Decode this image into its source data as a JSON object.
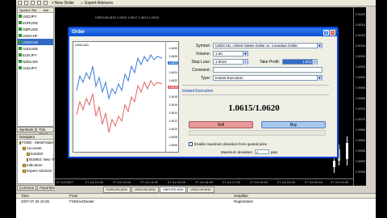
{
  "toolbar": {
    "new_order": "New Order",
    "expert_advisors": "Expert Advisors"
  },
  "market_watch": {
    "columns": [
      "Symbol",
      "Bid",
      "Ask"
    ],
    "symbols": [
      "USDJPY",
      "EURUSD",
      "GBPUSD",
      "USDCHF",
      "USDCAD",
      "AUDUSD",
      "EURJPY",
      "NZDUSD",
      "AUDJPY"
    ],
    "selected": "USDCAD",
    "tabs": [
      "Symbols",
      "Tick Chart"
    ]
  },
  "navigator": {
    "title": "Navigator",
    "items": [
      "FXDD - MetaTrader",
      "Accounts",
      "843300:",
      "915953: New Trader",
      "Indicators",
      "Expert Advisors"
    ],
    "tabs": [
      "Common",
      "Favorites"
    ]
  },
  "chart": {
    "title": "USDCAD,M15 1.0615 1.0617 1.0613 1.0615",
    "price_ticks": [
      "2.0020",
      "2.0015",
      "2.0010",
      "2.0005",
      "2.0000",
      "1.9995",
      "1.9990",
      "1.9985",
      "1.9980",
      "1.9975",
      "1.9970",
      "1.9965",
      "1.9960",
      "1.9955",
      "1.9950",
      "1.9945"
    ],
    "time_ticks": [
      "27 Jul 2007",
      "27 Jul 12:45",
      "27 Jul 13:45",
      "27 Jul 14:45",
      "27 Jul 15:45",
      "27 Jul 16:45",
      "27 Jul 17:45",
      "27 Jul 18:45",
      "27 Jul 19:45",
      "27 Jul 20:45",
      "27 Jul 21:45"
    ],
    "tabs": [
      "EURUSD,M15",
      "USDCAD,M15",
      "GBPUSD,M15",
      "USDCHF,M15"
    ],
    "active_tab": "GBPUSD,M15"
  },
  "terminal": {
    "tabs": [
      "Trade",
      "Account History",
      "News",
      "Alerts",
      "Mailbox",
      "Experts",
      "Journal"
    ],
    "columns": [
      "Time",
      "From",
      "Headline"
    ],
    "rows": [
      {
        "time": "2007.07.29 19:36",
        "from": "FXDirectDealer",
        "headline": "Registration"
      }
    ]
  },
  "dialog": {
    "title": "Order",
    "mini_chart": {
      "title": "USDCAD",
      "ticks": [
        "1.0630",
        "1.0628",
        "1.0626",
        "1.0624",
        "1.0622",
        "1.0620",
        "1.0618",
        "1.0616",
        "1.0614",
        "1.0612",
        "1.0610",
        "1.0608",
        "1.0606"
      ],
      "ask_badge": "1.0620",
      "bid_badge": "1.0615",
      "colors": {
        "ask_line": "#3a7ad8",
        "bid_line": "#e06060"
      }
    },
    "form": {
      "symbol_label": "Symbol:",
      "symbol_value": "USDCAD, United States Dollar vs. Canadian Dollar",
      "volume_label": "Volume:",
      "volume_value": "1.00",
      "stoploss_label": "Stop Loss:",
      "stoploss_value": "1.0019",
      "takeprofit_label": "Take Profit:",
      "takeprofit_value": "1.0612",
      "comment_label": "Comment:",
      "comment_value": "",
      "type_label": "Type:",
      "type_value": "Instant Execution"
    },
    "execution_title": "Instant Execution",
    "quote": "1.0615/1.0620",
    "sell_label": "Sell",
    "buy_label": "Buy",
    "enable_deviation_label": "Enable maximum deviation from quoted price",
    "max_deviation_label": "Maximum deviation:",
    "max_deviation_value": "0",
    "pips_label": "pips"
  }
}
